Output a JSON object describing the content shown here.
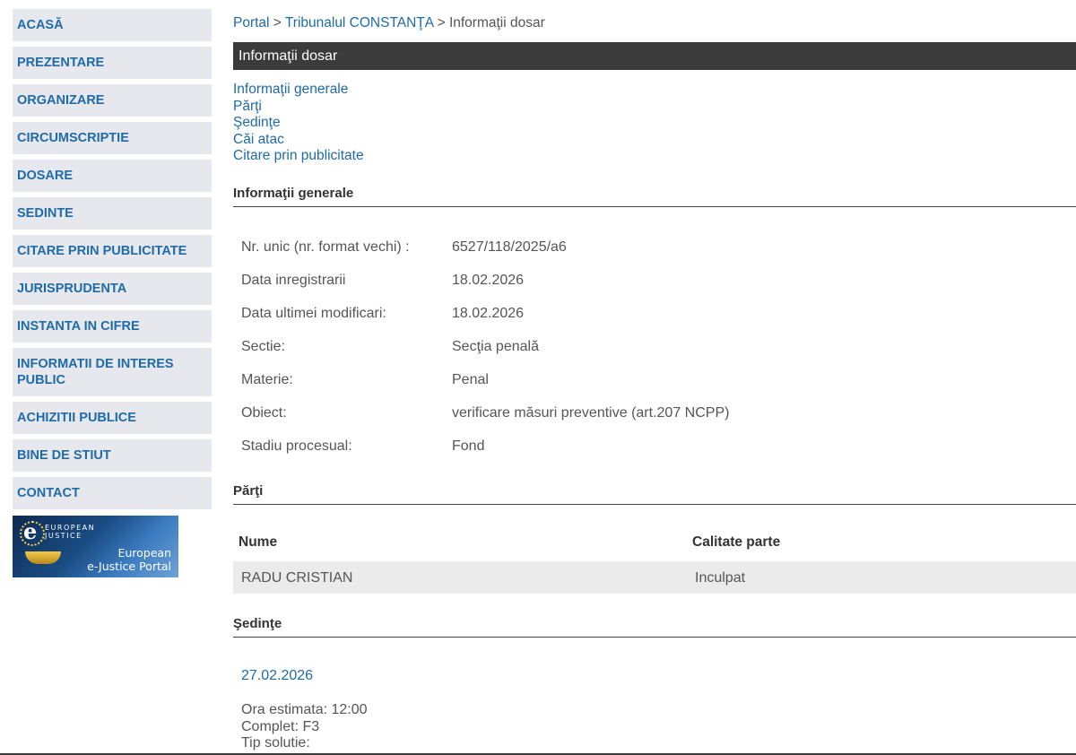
{
  "sidebar": {
    "items": [
      {
        "label": "ACASĂ"
      },
      {
        "label": "PREZENTARE"
      },
      {
        "label": "ORGANIZARE"
      },
      {
        "label": "CIRCUMSCRIPTIE"
      },
      {
        "label": "DOSARE"
      },
      {
        "label": "SEDINTE"
      },
      {
        "label": "CITARE PRIN PUBLICITATE"
      },
      {
        "label": "JURISPRUDENTA"
      },
      {
        "label": "INSTANTA IN CIFRE"
      },
      {
        "label": "INFORMATII DE INTERES PUBLIC"
      },
      {
        "label": "ACHIZITII PUBLICE"
      },
      {
        "label": "BINE DE STIUT"
      },
      {
        "label": "CONTACT"
      }
    ],
    "banner": {
      "small_text_1": "EUROPEAN",
      "small_text_2": "JUSTICE",
      "big_text_1": "European",
      "big_text_2": "e-Justice Portal"
    }
  },
  "breadcrumb": {
    "portal": "Portal",
    "sep1": " > ",
    "court": "Tribunalul CONSTANŢA",
    "sep2": " > ",
    "current": "Informaţii dosar"
  },
  "title_bar": "Informaţii dosar",
  "toc": [
    "Informaţii generale",
    "Părţi",
    "Şedinţe",
    "Căi atac",
    "Citare prin publicitate"
  ],
  "general": {
    "heading": "Informaţii generale",
    "rows": [
      {
        "label": "Nr. unic (nr. format vechi) :",
        "value": "6527/118/2025/a6"
      },
      {
        "label": "Data inregistrarii",
        "value": "18.02.2026"
      },
      {
        "label": "Data ultimei modificari:",
        "value": "18.02.2026"
      },
      {
        "label": "Sectie:",
        "value": "Secţia penală"
      },
      {
        "label": "Materie:",
        "value": "Penal"
      },
      {
        "label": "Obiect:",
        "value": "verificare măsuri preventive (art.207 NCPP)"
      },
      {
        "label": "Stadiu procesual:",
        "value": "Fond"
      }
    ]
  },
  "parti": {
    "heading": "Părţi",
    "columns": [
      "Nume",
      "Calitate parte"
    ],
    "rows": [
      {
        "name": "RADU CRISTIAN",
        "role": "Inculpat"
      }
    ]
  },
  "sedinte": {
    "heading": "Şedinţe",
    "date": "27.02.2026",
    "ora": "Ora estimata: 12:00",
    "complet": "Complet: F3",
    "tip_solutie": "Tip solutie:"
  }
}
